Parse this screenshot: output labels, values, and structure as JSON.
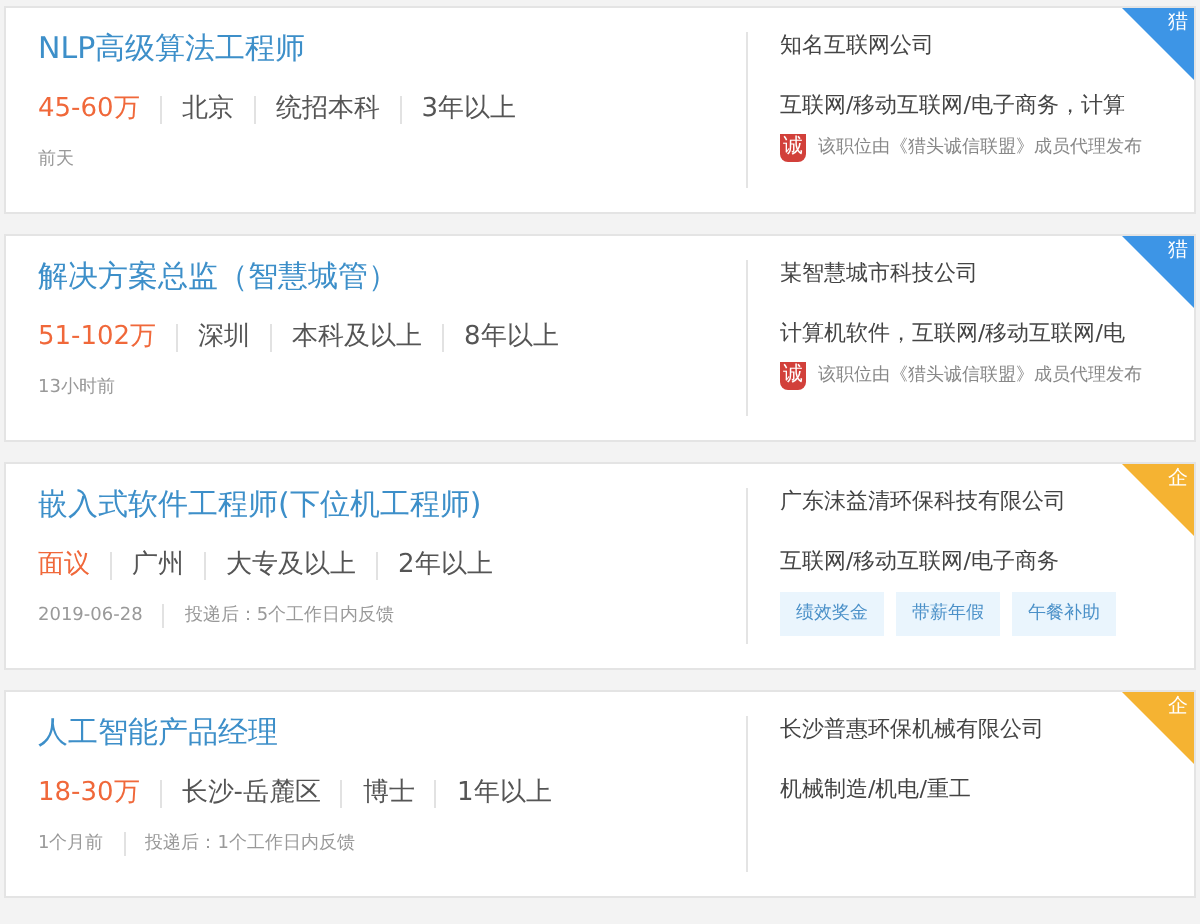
{
  "jobs": [
    {
      "title": "NLP高级算法工程师",
      "salary": "45-60万",
      "attributes": [
        "北京",
        "统招本科",
        "3年以上"
      ],
      "posted": "前天",
      "company": "知名互联网公司",
      "industry": "互联网/移动互联网/电子商务，计算",
      "corner": {
        "kind": "hunter",
        "label": "猎"
      },
      "note": {
        "icon": "诚",
        "text": "该职位由《猎头诚信联盟》成员代理发布"
      }
    },
    {
      "title": "解决方案总监（智慧城管）",
      "salary": "51-102万",
      "attributes": [
        "深圳",
        "本科及以上",
        "8年以上"
      ],
      "posted": "13小时前",
      "company": "某智慧城市科技公司",
      "industry": "计算机软件，互联网/移动互联网/电",
      "corner": {
        "kind": "hunter",
        "label": "猎"
      },
      "note": {
        "icon": "诚",
        "text": "该职位由《猎头诚信联盟》成员代理发布"
      }
    },
    {
      "title": "嵌入式软件工程师(下位机工程师)",
      "salary": "面议",
      "attributes": [
        "广州",
        "大专及以上",
        "2年以上"
      ],
      "posted": "2019-06-28",
      "feedback": "投递后：5个工作日内反馈",
      "company": "广东沫益清环保科技有限公司",
      "industry": "互联网/移动互联网/电子商务",
      "corner": {
        "kind": "company",
        "label": "企"
      },
      "tags": [
        "绩效奖金",
        "带薪年假",
        "午餐补助"
      ]
    },
    {
      "title": "人工智能产品经理",
      "salary": "18-30万",
      "attributes": [
        "长沙-岳麓区",
        "博士",
        "1年以上"
      ],
      "posted": "1个月前",
      "feedback": "投递后：1个工作日内反馈",
      "company": "长沙普惠环保机械有限公司",
      "industry": "机械制造/机电/重工",
      "corner": {
        "kind": "company",
        "label": "企"
      }
    }
  ]
}
